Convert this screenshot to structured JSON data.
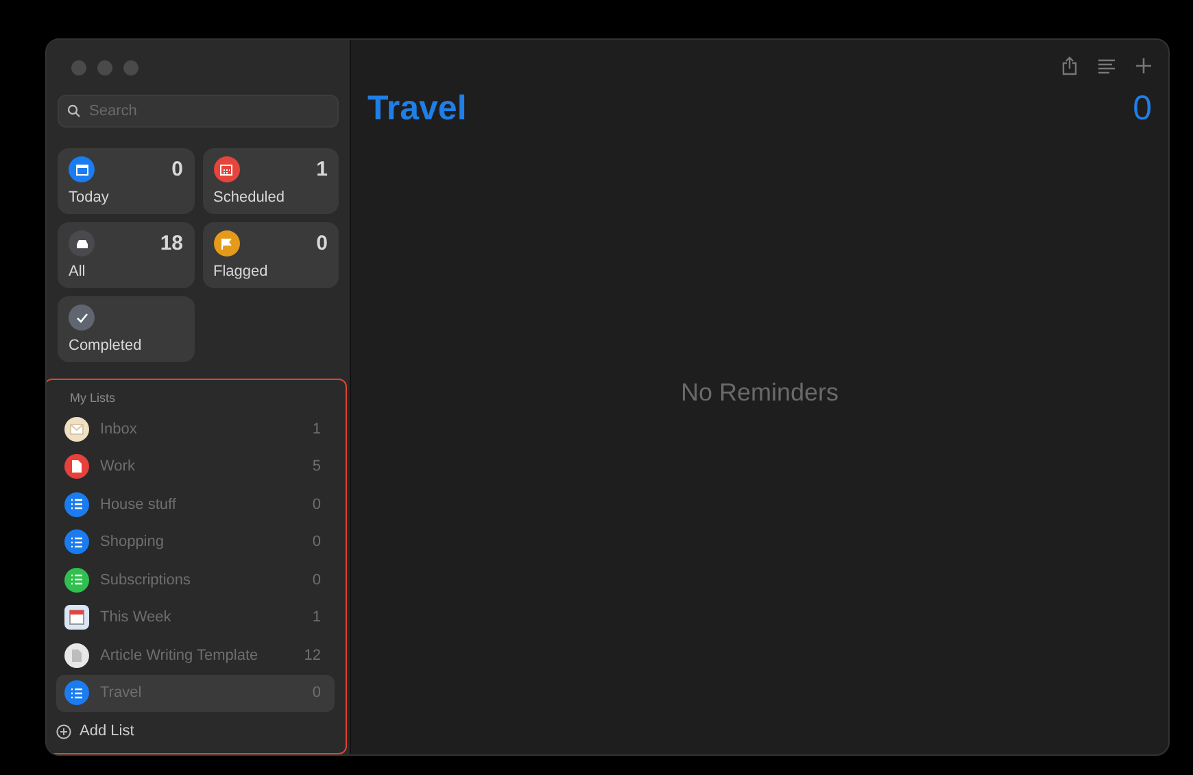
{
  "search": {
    "placeholder": "Search"
  },
  "smart_lists": [
    {
      "label": "Today",
      "count": "0",
      "kind": "calendar",
      "color": "#1a7cf0"
    },
    {
      "label": "Scheduled",
      "count": "1",
      "kind": "grid",
      "color": "#e5453c"
    },
    {
      "label": "All",
      "count": "18",
      "kind": "tray",
      "color": "#4a4a4e"
    },
    {
      "label": "Flagged",
      "count": "0",
      "kind": "flag",
      "color": "#e69a1a"
    },
    {
      "label": "Completed",
      "kind": "check",
      "color": "#5f6670"
    }
  ],
  "my_lists": {
    "heading": "My Lists",
    "highlighted": true,
    "items": [
      {
        "name": "Inbox",
        "count": "1",
        "kind": "envelope",
        "color": "#f1dfc4",
        "selected": false
      },
      {
        "name": "Work",
        "count": "5",
        "kind": "document",
        "color": "#e8403a",
        "selected": false
      },
      {
        "name": "House stuff",
        "count": "0",
        "kind": "list",
        "color": "#1a7cf0",
        "selected": false
      },
      {
        "name": "Shopping",
        "count": "0",
        "kind": "list",
        "color": "#1a7cf0",
        "selected": false
      },
      {
        "name": "Subscriptions",
        "count": "0",
        "kind": "list",
        "color": "#30c04f",
        "selected": false
      },
      {
        "name": "This Week",
        "count": "1",
        "kind": "calendar",
        "color": "#d9e6f5",
        "selected": false
      },
      {
        "name": "Article Writing Template",
        "count": "12",
        "kind": "file",
        "color": "#e8e8e8",
        "selected": false
      },
      {
        "name": "Travel",
        "count": "0",
        "kind": "list",
        "color": "#1a7cf0",
        "selected": true
      }
    ]
  },
  "add_list": "Add List",
  "main": {
    "title": "Travel",
    "count": "0",
    "empty_message": "No Reminders"
  }
}
